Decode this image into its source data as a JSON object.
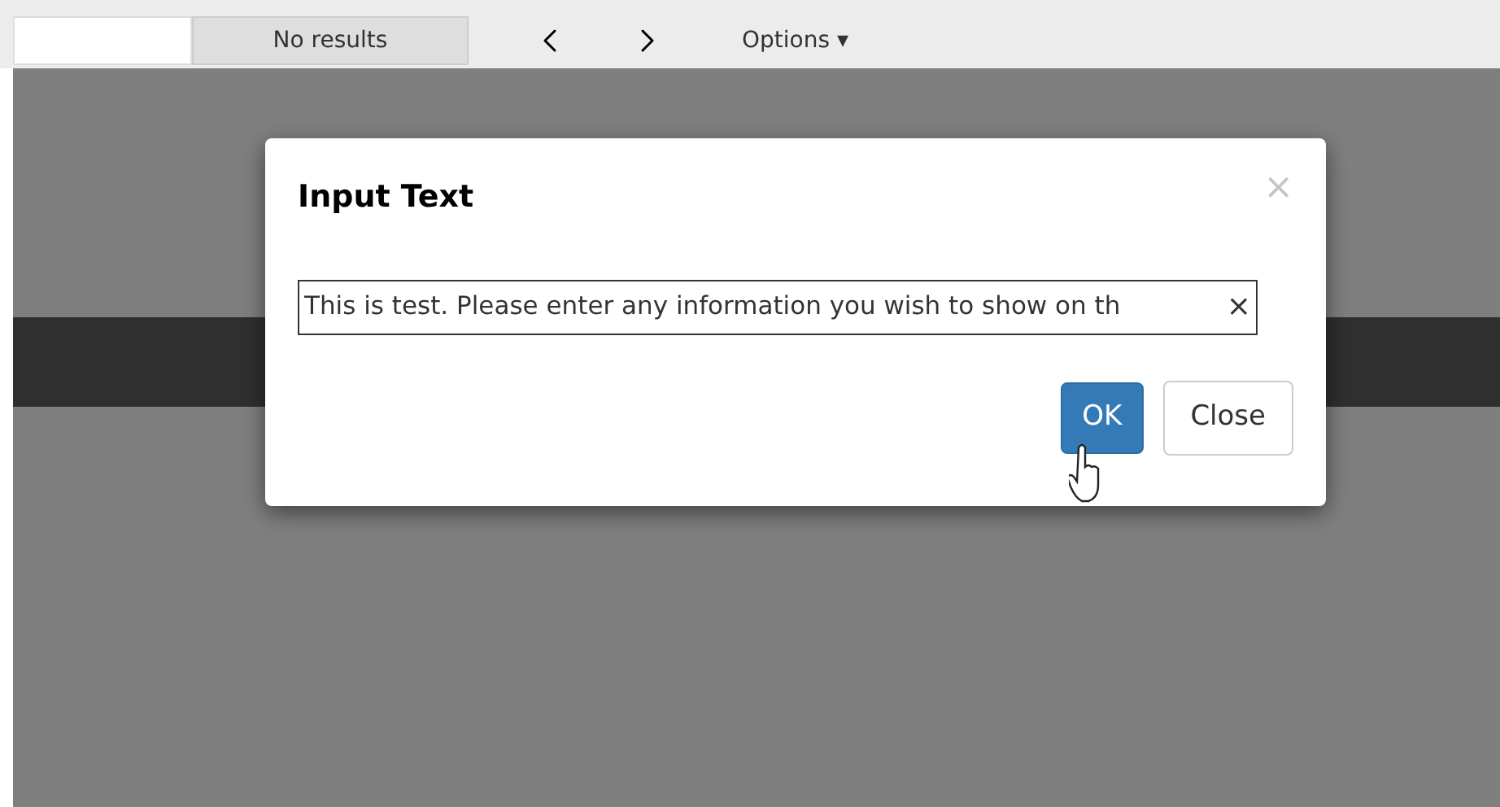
{
  "toolbar": {
    "results_label": "No results",
    "options_label": "Options ▾"
  },
  "dialog": {
    "title": "Input Text",
    "close_glyph": "×",
    "field": {
      "value": "This is test. Please enter any information you wish to show on th",
      "clear_glyph": "×"
    },
    "buttons": [
      {
        "label": "OK",
        "kind": "primary"
      },
      {
        "label": "Close",
        "kind": "default"
      }
    ]
  }
}
